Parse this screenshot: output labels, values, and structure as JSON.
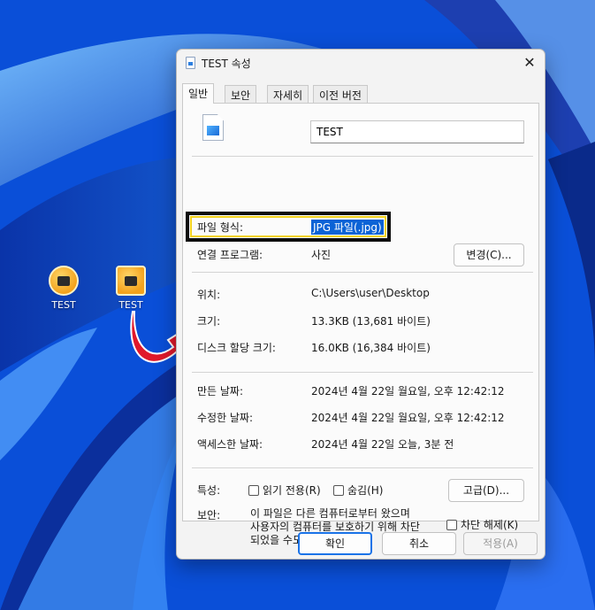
{
  "desktop": {
    "icons": [
      {
        "label": "TEST"
      },
      {
        "label": "TEST"
      }
    ]
  },
  "dialog": {
    "title": "TEST 속성",
    "close_glyph": "✕",
    "tabs": [
      "일반",
      "보안",
      "자세히",
      "이전 버전"
    ],
    "file_name": "TEST",
    "file_type": {
      "label": "파일 형식:",
      "value": "JPG 파일(.jpg)"
    },
    "opens_with": {
      "label": "연결 프로그램:",
      "value": "사진",
      "button": "변경(C)..."
    },
    "location": {
      "label": "위치:",
      "value": "C:\\Users\\user\\Desktop"
    },
    "size": {
      "label": "크기:",
      "value": "13.3KB (13,681 바이트)"
    },
    "size_on_disk": {
      "label": "디스크 할당 크기:",
      "value": "16.0KB (16,384 바이트)"
    },
    "created": {
      "label": "만든 날짜:",
      "value": "2024년 4월 22일 월요일, 오후 12:42:12"
    },
    "modified": {
      "label": "수정한 날짜:",
      "value": "2024년 4월 22일 월요일, 오후 12:42:12"
    },
    "accessed": {
      "label": "액세스한 날짜:",
      "value": "2024년 4월 22일 오늘, 3분 전"
    },
    "attributes": {
      "label": "특성:",
      "readonly": "읽기 전용(R)",
      "hidden": "숨김(H)",
      "advanced_button": "고급(D)..."
    },
    "security": {
      "label": "보안:",
      "line1": "이 파일은 다른 컴퓨터로부터 왔으며",
      "line2": "사용자의 컴퓨터를 보호하기 위해 차단",
      "line3": "되었을 수도 있습니다.",
      "unblock": "차단 해제(K)"
    },
    "buttons": {
      "ok": "확인",
      "cancel": "취소",
      "apply": "적용(A)"
    }
  },
  "colors": {
    "wallpaper_base": "#0a4fd8",
    "highlight_outline": "#f3d21c",
    "selection": "#0b63d6",
    "arrow": "#e0182b"
  }
}
